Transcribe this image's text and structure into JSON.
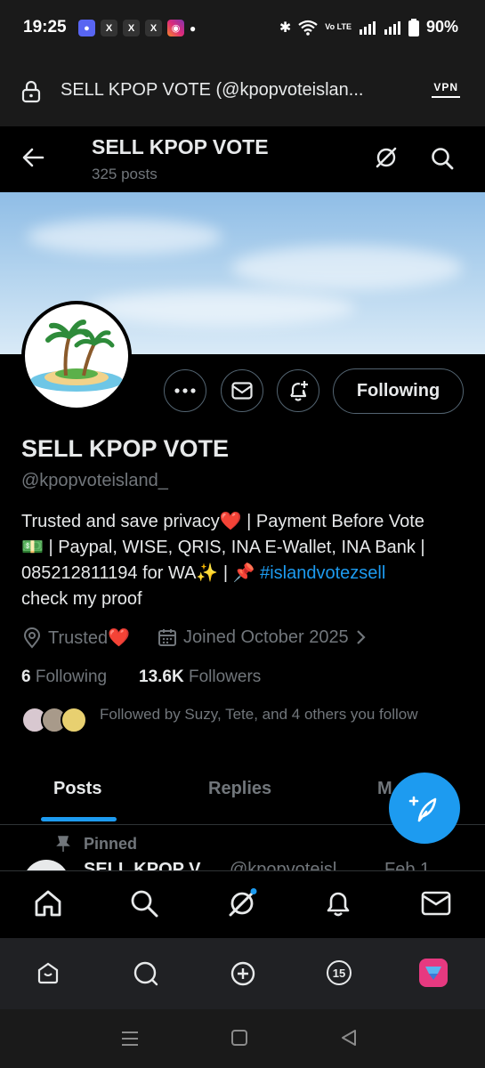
{
  "status": {
    "time": "19:25",
    "battery": "90%",
    "network": "Vo LTE"
  },
  "browser": {
    "url_text": "SELL KPOP VOTE (@kpopvoteislan...",
    "vpn_label": "VPN"
  },
  "header": {
    "title": "SELL KPOP VOTE",
    "post_count": "325 posts"
  },
  "profile": {
    "name": "SELL KPOP VOTE",
    "handle": "@kpopvoteisland_",
    "bio_line1": "Trusted and save privacy❤️ | Payment Before Vote",
    "bio_line2": "💵 | Paypal, WISE, QRIS, INA E-Wallet, INA Bank |",
    "bio_line3": "085212811194 for WA✨ | 📌 ",
    "bio_hashtag": "#islandvotezsell",
    "bio_line4": "check my proof",
    "location": "Trusted❤️",
    "joined": "Joined October 2025",
    "following_count": "6",
    "following_label": "Following",
    "followers_count": "13.6K",
    "followers_label": "Followers",
    "followed_by": "Followed by Suzy, Tete, and 4 others you follow",
    "follow_button": "Following"
  },
  "tabs": [
    "Posts",
    "Replies",
    "M"
  ],
  "pinned_label": "Pinned",
  "cut_post": {
    "name": "SELL KPOP V...",
    "handle": "@kpopvoteisl...",
    "date": "Feb 1"
  },
  "tray": {
    "count_badge": "15"
  },
  "colors": {
    "accent": "#1d9bf0",
    "muted": "#71767b",
    "text": "#e7e9ea"
  },
  "icons": [
    "back-arrow-icon",
    "grok-icon",
    "search-icon",
    "more-icon",
    "mail-icon",
    "bell-plus-icon",
    "location-icon",
    "calendar-icon",
    "chevron-right-icon",
    "compose-icon",
    "home-icon",
    "bell-icon"
  ]
}
